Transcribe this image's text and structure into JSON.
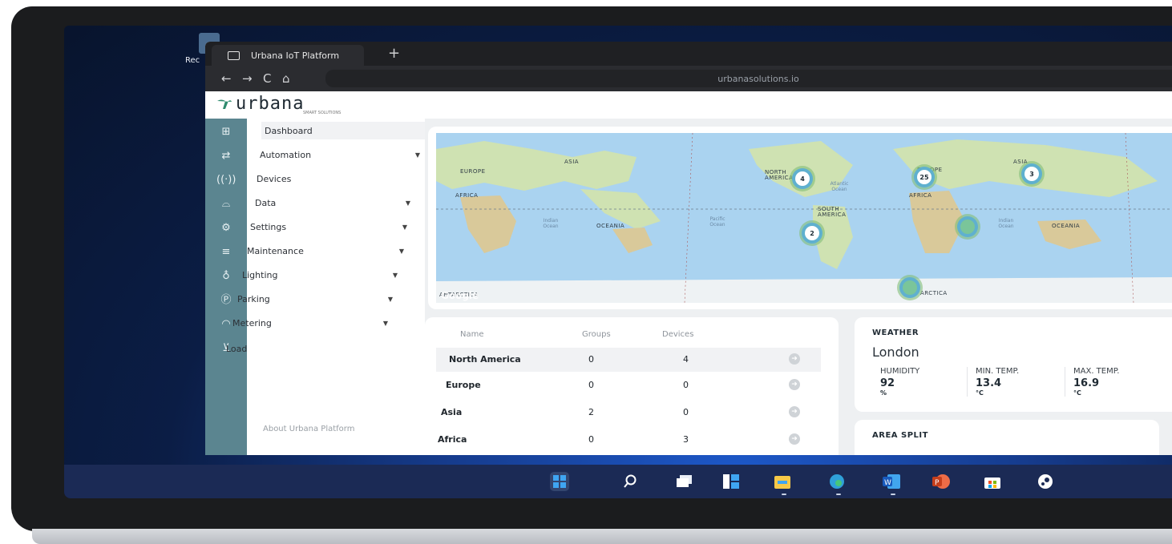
{
  "desktop": {
    "icon_label": "Rec"
  },
  "browser": {
    "tab_title": "Urbana IoT Platform",
    "new_tab": "+",
    "nav": {
      "back": "←",
      "forward": "→",
      "reload": "C",
      "home": "⌂"
    },
    "url": "urbanasolutions.io"
  },
  "app": {
    "logo_text": "urbana",
    "logo_tagline": "SMART SOLUTIONS",
    "menu": [
      {
        "label": "Dashboard",
        "icon": "grid-icon",
        "caret": false
      },
      {
        "label": "Automation",
        "icon": "arrows-icon",
        "caret": true
      },
      {
        "label": "Devices",
        "icon": "signal-icon",
        "caret": false
      },
      {
        "label": "Data",
        "icon": "inbox-icon",
        "caret": true
      },
      {
        "label": "Settings",
        "icon": "gear-icon",
        "caret": true
      },
      {
        "label": "Maintenance",
        "icon": "sliders-icon",
        "caret": true
      },
      {
        "label": "Lighting",
        "icon": "bulb-icon",
        "caret": true
      },
      {
        "label": "Parking",
        "icon": "parking-icon",
        "caret": true
      },
      {
        "label": "Metering",
        "icon": "gauge-icon",
        "caret": true
      },
      {
        "label": "Load",
        "icon": "plug-icon",
        "caret": false
      }
    ],
    "about": "About Urbana Platform"
  },
  "map": {
    "continent_labels": [
      "EUROPE",
      "ASIA",
      "AFRICA",
      "NORTH AMERICA",
      "EUROPE",
      "ASIA",
      "AFRICA",
      "SOUTH AMERICA",
      "OCEANIA",
      "OCEANIA",
      "ANTARCTICA",
      "ARCTICA"
    ],
    "ocean_labels": [
      "Indian Ocean",
      "Pacific Ocean",
      "Atlantic Ocean",
      "Indian Ocean"
    ],
    "clusters": [
      "4",
      "25",
      "3",
      "2",
      "",
      ""
    ],
    "attribution": "Google"
  },
  "table": {
    "headers": [
      "Name",
      "Groups",
      "Devices"
    ],
    "rows": [
      {
        "name": "North America",
        "groups": "0",
        "devices": "4"
      },
      {
        "name": "Europe",
        "groups": "0",
        "devices": "0"
      },
      {
        "name": "Asia",
        "groups": "2",
        "devices": "0"
      },
      {
        "name": "Africa",
        "groups": "0",
        "devices": "3"
      }
    ]
  },
  "weather": {
    "title": "WEATHER",
    "city": "London",
    "metrics": [
      {
        "label": "HUMIDITY",
        "value": "92",
        "unit": "%"
      },
      {
        "label": "MIN. TEMP.",
        "value": "13.4",
        "unit": "°C"
      },
      {
        "label": "MAX. TEMP.",
        "value": "16.9",
        "unit": "°C"
      }
    ]
  },
  "area_split": {
    "title": "AREA SPLIT"
  },
  "taskbar": {
    "icons": [
      "windows-start-icon",
      "search-icon",
      "task-view-icon",
      "widgets-icon",
      "file-explorer-icon",
      "edge-icon",
      "word-icon",
      "powerpoint-icon",
      "store-icon",
      "steam-icon"
    ]
  },
  "colors": {
    "rail": "#5b8590",
    "map_water": "#aad3f0",
    "cluster": "#5fb0cf",
    "taskbar": "#1b2a55"
  }
}
